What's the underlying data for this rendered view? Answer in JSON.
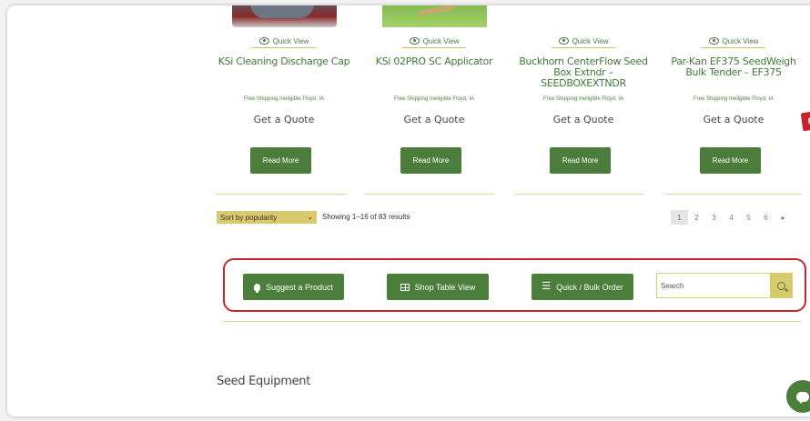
{
  "products": [
    {
      "quick_view": "Quick View",
      "title": "KSi Cleaning Discharge Cap",
      "shipping": "Free Shipping Ineligible Floyd, IA",
      "price_text": "Get a Quote",
      "button": "Read More"
    },
    {
      "quick_view": "Quick View",
      "title": "KSi 02PRO SC Applicator",
      "shipping": "Free Shipping Ineligible Floyd, IA",
      "price_text": "Get a Quote",
      "button": "Read More"
    },
    {
      "quick_view": "Quick View",
      "title": "Buckhorn CenterFlow Seed Box Extndr – SEEDBOXEXTNDR",
      "shipping": "Free Shipping Ineligible Floyd, IA",
      "price_text": "Get a Quote",
      "button": "Read More"
    },
    {
      "quick_view": "Quick View",
      "title": "Par-Kan EF375 SeedWeigh Bulk Tender – EF375",
      "shipping": "Free Shipping Ineligible Floyd, IA",
      "price_text": "Get a Quote",
      "button": "Read More"
    }
  ],
  "sort": {
    "selected": "Sort by popularity"
  },
  "results_text": "Showing 1–16 of 83 results",
  "pagination": {
    "pages": [
      "1",
      "2",
      "3",
      "4",
      "5",
      "6"
    ],
    "next": "▸",
    "current": "1"
  },
  "toolbar": {
    "suggest": "Suggest a Product",
    "table_view": "Shop Table View",
    "bulk_order": "Quick / Bulk Order",
    "search_placeholder": "Search"
  },
  "section_heading": "Seed Equipment",
  "promo_badge": "D",
  "colors": {
    "brand_green": "#4b7d3b",
    "accent_gold": "#d9c96d",
    "highlight_red": "#c8232c"
  }
}
